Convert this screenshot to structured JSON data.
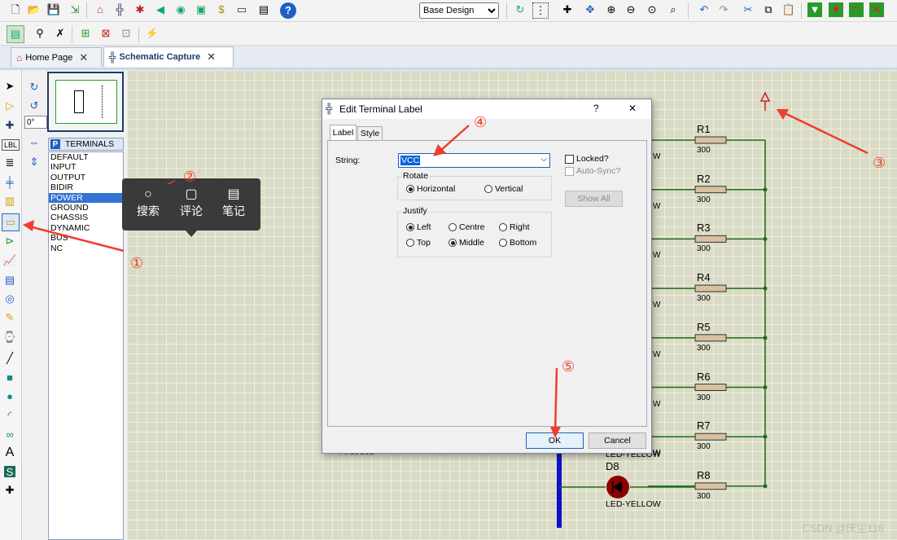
{
  "toolbar": {
    "design_select": "Base Design"
  },
  "tabs": [
    {
      "label": "Home Page"
    },
    {
      "label": "Schematic Capture"
    }
  ],
  "left_panel": {
    "rotation": "0°",
    "selector_badge": "P",
    "selector_title": "TERMINALS",
    "terminals": [
      "DEFAULT",
      "INPUT",
      "OUTPUT",
      "BIDIR",
      "POWER",
      "GROUND",
      "CHASSIS",
      "DYNAMIC",
      "BUS",
      "NC"
    ],
    "selected": "POWER"
  },
  "context_popup": {
    "items": [
      {
        "label": "搜索",
        "icon": "search-icon"
      },
      {
        "label": "评论",
        "icon": "comment-icon"
      },
      {
        "label": "笔记",
        "icon": "note-icon"
      }
    ]
  },
  "dialog": {
    "title": "Edit Terminal Label",
    "help": "?",
    "close": "✕",
    "tabs": [
      "Label",
      "Style"
    ],
    "string_label": "String:",
    "string_value": "VCC",
    "locked_label": "Locked?",
    "autosync_label": "Auto-Sync?",
    "show_all": "Show All",
    "rotate": {
      "title": "Rotate",
      "options": [
        "Horizontal",
        "Vertical"
      ],
      "selected": "Horizontal"
    },
    "justify": {
      "title": "Justify",
      "row1": [
        "Left",
        "Centre",
        "Right"
      ],
      "row2": [
        "Top",
        "Middle",
        "Bottom"
      ],
      "selected": [
        "Left",
        "Middle"
      ]
    },
    "ok": "OK",
    "cancel": "Cancel"
  },
  "schematic": {
    "resistors": [
      {
        "ref": "R1",
        "value": "300"
      },
      {
        "ref": "R2",
        "value": "300"
      },
      {
        "ref": "R3",
        "value": "300"
      },
      {
        "ref": "R4",
        "value": "300"
      },
      {
        "ref": "R5",
        "value": "300"
      },
      {
        "ref": "R6",
        "value": "300"
      },
      {
        "ref": "R7",
        "value": "300"
      },
      {
        "ref": "R8",
        "value": "300"
      }
    ],
    "partial_label": "W",
    "led_ref": "D8",
    "led_value_upper": "LED-YELLOW",
    "led_value": "LED-YELLOW",
    "partial_left": "AT89C51"
  },
  "annotations": [
    "①",
    "②",
    "③",
    "④",
    "⑤"
  ],
  "watermark": "CSDN @庆尘118",
  "colors": {
    "wire": "#1f6b1f",
    "bus": "#1010c8",
    "annotation": "#ef3d2e",
    "selection": "#3373d3"
  }
}
